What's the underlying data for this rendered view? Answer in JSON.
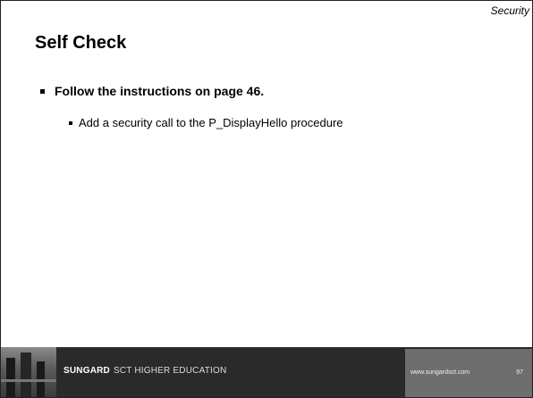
{
  "header": {
    "section_label": "Security"
  },
  "slide": {
    "title": "Self Check",
    "bullets": [
      {
        "text": "Follow the instructions on page 46.",
        "sub_bullets": [
          "Add a security call to the P_DisplayHello procedure"
        ]
      }
    ]
  },
  "footer": {
    "brand": "SUNGARD",
    "division": "SCT HIGHER EDUCATION",
    "url": "www.sungardsct.com",
    "page_number": "97"
  },
  "colors": {
    "footer_dark": "#2a2a2a",
    "footer_panel": "#6e6e6e",
    "text": "#000000"
  }
}
